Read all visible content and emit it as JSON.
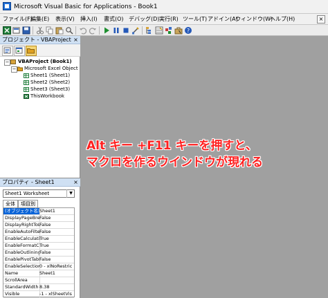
{
  "window": {
    "title": "Microsoft Visual Basic for Applications - Book1"
  },
  "menu": {
    "items": [
      "ファイル(F)",
      "編集(E)",
      "表示(V)",
      "挿入(I)",
      "書式(O)",
      "デバッグ(D)",
      "実行(R)",
      "ツール(T)",
      "アドイン(A)",
      "ウィンドウ(W)",
      "ヘルプ(H)"
    ],
    "end_button": "×"
  },
  "toolbar": {
    "icons": [
      "excel-icon",
      "insert-icon",
      "save-icon",
      "cut-icon",
      "copy-icon",
      "paste-icon",
      "find-icon",
      "undo-icon",
      "redo-icon",
      "run-icon",
      "break-icon",
      "reset-icon",
      "design-mode-icon",
      "project-explorer-icon",
      "properties-icon",
      "object-browser-icon",
      "toolbox-icon",
      "help-icon"
    ]
  },
  "project_pane": {
    "title": "プロジェクト - VBAProject",
    "close": "×",
    "tree": {
      "root": "VBAProject (Book1)",
      "folder": "Microsoft Excel Object",
      "items": [
        "Sheet1 (Sheet1)",
        "Sheet2 (Sheet2)",
        "Sheet3 (Sheet3)",
        "ThisWorkbook"
      ]
    }
  },
  "properties_pane": {
    "title": "プロパティ - Sheet1",
    "close": "×",
    "object_select": "Sheet1 Worksheet",
    "tabs": [
      "全体",
      "項目別"
    ],
    "rows": [
      {
        "name": "(オブジェクト名)",
        "value": "Sheet1"
      },
      {
        "name": "DisplayPageBrea",
        "value": "False"
      },
      {
        "name": "DisplayRightToLe",
        "value": "False"
      },
      {
        "name": "EnableAutoFilter",
        "value": "False"
      },
      {
        "name": "EnableCalculatio",
        "value": "True"
      },
      {
        "name": "EnableFormatCor",
        "value": "True"
      },
      {
        "name": "EnableOutlining",
        "value": "False"
      },
      {
        "name": "EnablePivotTable",
        "value": "False"
      },
      {
        "name": "EnableSelection",
        "value": "0 - xlNoRestric"
      },
      {
        "name": "Name",
        "value": "Sheet1"
      },
      {
        "name": "ScrollArea",
        "value": ""
      },
      {
        "name": "StandardWidth",
        "value": "8.38"
      },
      {
        "name": "Visible",
        "value": "-1 - xlSheetVis"
      }
    ]
  },
  "caption": {
    "line1": "Alt キー +F11 キーを押すと、",
    "line2": "マクロを作るウインドウが現れる",
    "color": "#ff2020"
  }
}
